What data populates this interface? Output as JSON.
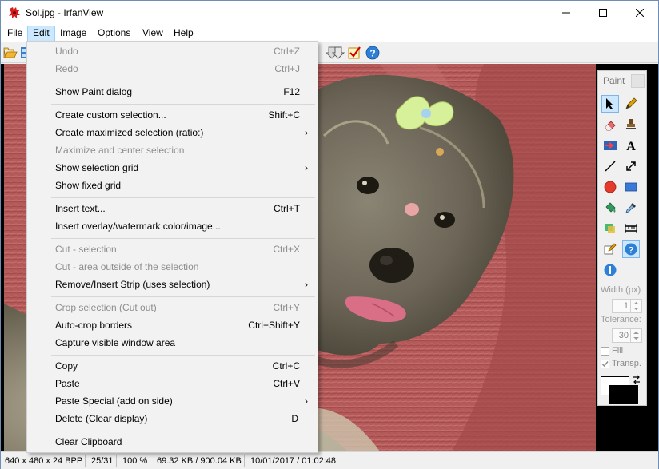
{
  "window": {
    "title": "Sol.jpg - IrfanView"
  },
  "menubar": {
    "items": [
      "File",
      "Edit",
      "Image",
      "Options",
      "View",
      "Help"
    ]
  },
  "edit_menu": {
    "items": [
      {
        "label": "Undo",
        "shortcut": "Ctrl+Z",
        "enabled": false,
        "submenu": false
      },
      {
        "label": "Redo",
        "shortcut": "Ctrl+J",
        "enabled": false,
        "submenu": false
      },
      {
        "sep": true
      },
      {
        "label": "Show Paint dialog",
        "shortcut": "F12",
        "enabled": true,
        "submenu": false
      },
      {
        "sep": true
      },
      {
        "label": "Create custom selection...",
        "shortcut": "Shift+C",
        "enabled": true,
        "submenu": false
      },
      {
        "label": "Create maximized selection (ratio:)",
        "shortcut": "",
        "enabled": true,
        "submenu": true
      },
      {
        "label": "Maximize and center selection",
        "shortcut": "",
        "enabled": false,
        "submenu": false
      },
      {
        "label": "Show selection grid",
        "shortcut": "",
        "enabled": true,
        "submenu": true
      },
      {
        "label": "Show fixed grid",
        "shortcut": "",
        "enabled": true,
        "submenu": false
      },
      {
        "sep": true
      },
      {
        "label": "Insert text...",
        "shortcut": "Ctrl+T",
        "enabled": true,
        "submenu": false
      },
      {
        "label": "Insert overlay/watermark color/image...",
        "shortcut": "",
        "enabled": true,
        "submenu": false
      },
      {
        "sep": true
      },
      {
        "label": "Cut - selection",
        "shortcut": "Ctrl+X",
        "enabled": false,
        "submenu": false
      },
      {
        "label": "Cut - area outside of the selection",
        "shortcut": "",
        "enabled": false,
        "submenu": false
      },
      {
        "label": "Remove/Insert Strip (uses selection)",
        "shortcut": "",
        "enabled": true,
        "submenu": true
      },
      {
        "sep": true
      },
      {
        "label": "Crop selection (Cut out)",
        "shortcut": "Ctrl+Y",
        "enabled": false,
        "submenu": false
      },
      {
        "label": "Auto-crop borders",
        "shortcut": "Ctrl+Shift+Y",
        "enabled": true,
        "submenu": false
      },
      {
        "label": "Capture visible window area",
        "shortcut": "",
        "enabled": true,
        "submenu": false
      },
      {
        "sep": true
      },
      {
        "label": "Copy",
        "shortcut": "Ctrl+C",
        "enabled": true,
        "submenu": false
      },
      {
        "label": "Paste",
        "shortcut": "Ctrl+V",
        "enabled": true,
        "submenu": false
      },
      {
        "label": "Paste Special (add on side)",
        "shortcut": "",
        "enabled": true,
        "submenu": true
      },
      {
        "label": "Delete (Clear display)",
        "shortcut": "D",
        "enabled": true,
        "submenu": false
      },
      {
        "sep": true
      },
      {
        "label": "Clear Clipboard",
        "shortcut": "",
        "enabled": true,
        "submenu": false
      }
    ]
  },
  "paint": {
    "title": "Paint",
    "width_label": "Width (px)",
    "width_value": "1",
    "tolerance_label": "Tolerance:",
    "tolerance_value": "30",
    "fill_label": "Fill",
    "transp_label": "Transp.",
    "fill_checked": false,
    "transp_checked": true
  },
  "status": {
    "dimensions": "640 x 480 x 24 BPP",
    "index": "25/31",
    "zoom": "100 %",
    "size": "69.32 KB / 900.04 KB",
    "datetime": "10/01/2017 / 01:02:48"
  },
  "colors": {
    "accent": "#cce8ff",
    "accent_border": "#99d1ff",
    "canvas": "#000000"
  }
}
